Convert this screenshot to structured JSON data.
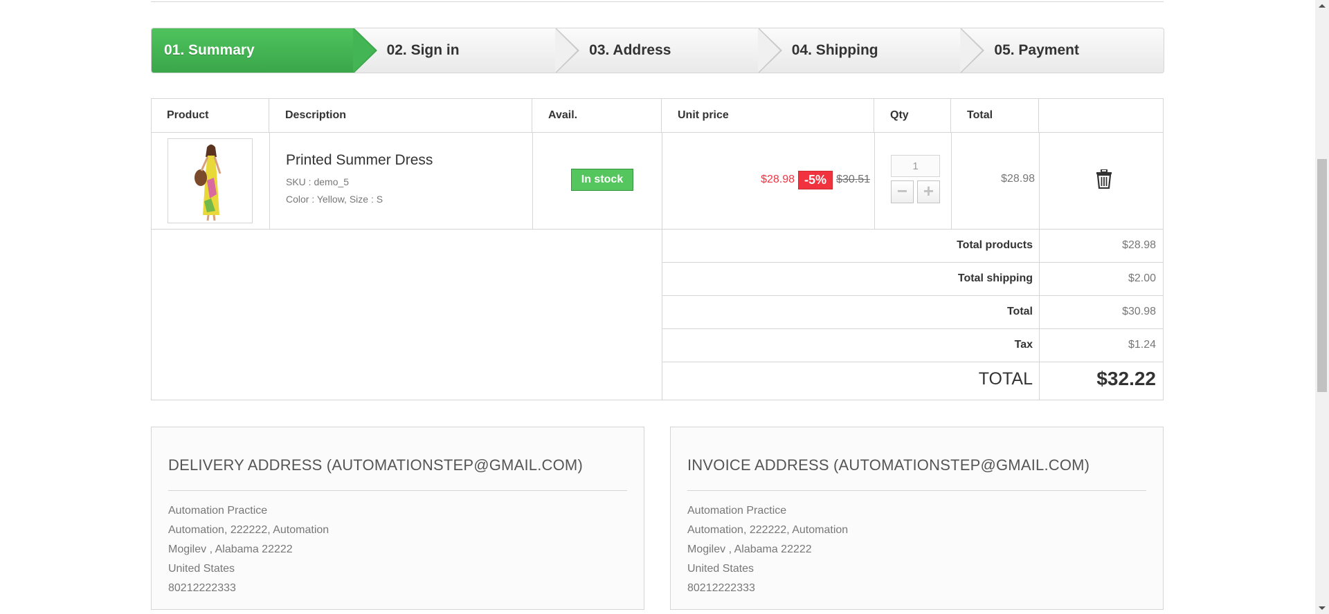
{
  "steps": [
    {
      "label": "01. Summary"
    },
    {
      "label": "02. Sign in"
    },
    {
      "label": "03. Address"
    },
    {
      "label": "04. Shipping"
    },
    {
      "label": "05. Payment"
    }
  ],
  "cart": {
    "headers": {
      "product": "Product",
      "description": "Description",
      "avail": "Avail.",
      "unit_price": "Unit price",
      "qty": "Qty",
      "total": "Total"
    },
    "item": {
      "image_icon": "dress-photo",
      "name": "Printed Summer Dress",
      "sku": "SKU : demo_5",
      "attributes": "Color : Yellow, Size : S",
      "availability": "In stock",
      "price_special": "$28.98",
      "price_reduction": "-5%",
      "price_old": "$30.51",
      "qty": "1",
      "minus_icon": "minus-icon",
      "plus_icon": "plus-icon",
      "line_total": "$28.98",
      "delete_icon": "trash-icon"
    },
    "summary": [
      {
        "label": "Total products",
        "value": "$28.98"
      },
      {
        "label": "Total shipping",
        "value": "$2.00"
      },
      {
        "label": "Total",
        "value": "$30.98"
      },
      {
        "label": "Tax",
        "value": "$1.24"
      }
    ],
    "grand_total": {
      "label": "TOTAL",
      "value": "$32.22"
    }
  },
  "delivery": {
    "title": "DELIVERY ADDRESS (AUTOMATIONSTEP@GMAIL.COM)",
    "lines": [
      "Automation Practice",
      "Automation, 222222, Automation",
      "Mogilev , Alabama 22222",
      "United States",
      "80212222333"
    ]
  },
  "invoice": {
    "title": "INVOICE ADDRESS (AUTOMATIONSTEP@GMAIL.COM)",
    "lines": [
      "Automation Practice",
      "Automation, 222222, Automation",
      "Mogilev , Alabama 22222",
      "United States",
      "80212222333"
    ]
  },
  "colors": {
    "active_step": "#46b754",
    "in_stock": "#55c65e",
    "discount": "#f13340"
  }
}
